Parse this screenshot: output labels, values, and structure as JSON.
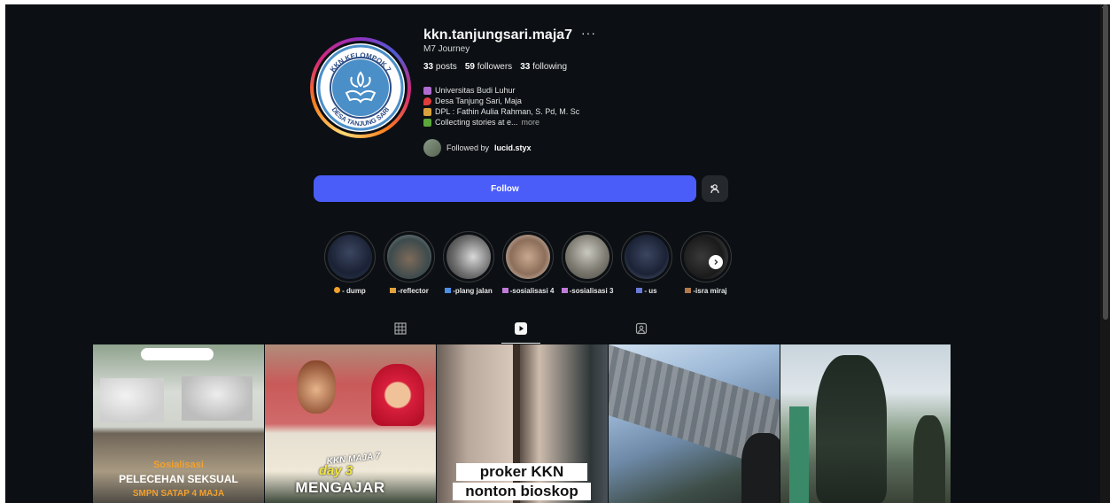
{
  "profile": {
    "username": "kkn.tanjungsari.maja7",
    "more_label": "···",
    "full_name": "M7 Journey",
    "stats": {
      "posts_count": "33",
      "posts_label": "posts",
      "followers_count": "59",
      "followers_label": "followers",
      "following_count": "33",
      "following_label": "following"
    },
    "bio": [
      "Universitas Budi Luhur",
      "Desa Tanjung Sari, Maja",
      "DPL : Fathin Aulia Rahman, S. Pd, M. Sc",
      "Collecting stories at e..."
    ],
    "bio_more": "more",
    "followed_by_prefix": "Followed by",
    "followed_by_user": "lucid.styx",
    "logo_text_top": "KKN KELOMPOK 7",
    "logo_text_bottom": "DESA TANJUNG SARI"
  },
  "actions": {
    "follow_label": "Follow",
    "suggest_icon": "person-add-icon"
  },
  "highlights": [
    {
      "label": "- dump"
    },
    {
      "label": "-reflector"
    },
    {
      "label": "-plang jalan"
    },
    {
      "label": "-sosialisasi 4"
    },
    {
      "label": "-sosialisasi 3"
    },
    {
      "label": "- us"
    },
    {
      "label": "-isra miraj"
    }
  ],
  "tabs": [
    {
      "icon": "grid-icon"
    },
    {
      "icon": "reels-icon",
      "active": true
    },
    {
      "icon": "tagged-icon"
    }
  ],
  "posts": [
    {
      "caption_top": "Sosialisasi",
      "caption_mid": "PELECEHAN SEKSUAL",
      "caption_bottom": "SMPN SATAP 4 MAJA"
    },
    {
      "caption_top": "KKN MAJA 7",
      "caption_mid": "day 3",
      "caption_bottom": "MENGAJAR"
    },
    {
      "caption_top": "proker KKN",
      "caption_bottom": "nonton bioskop"
    },
    {},
    {}
  ],
  "colors": {
    "background": "#0c1014",
    "follow_button": "#4a5df9",
    "secondary_button": "#25292e"
  }
}
